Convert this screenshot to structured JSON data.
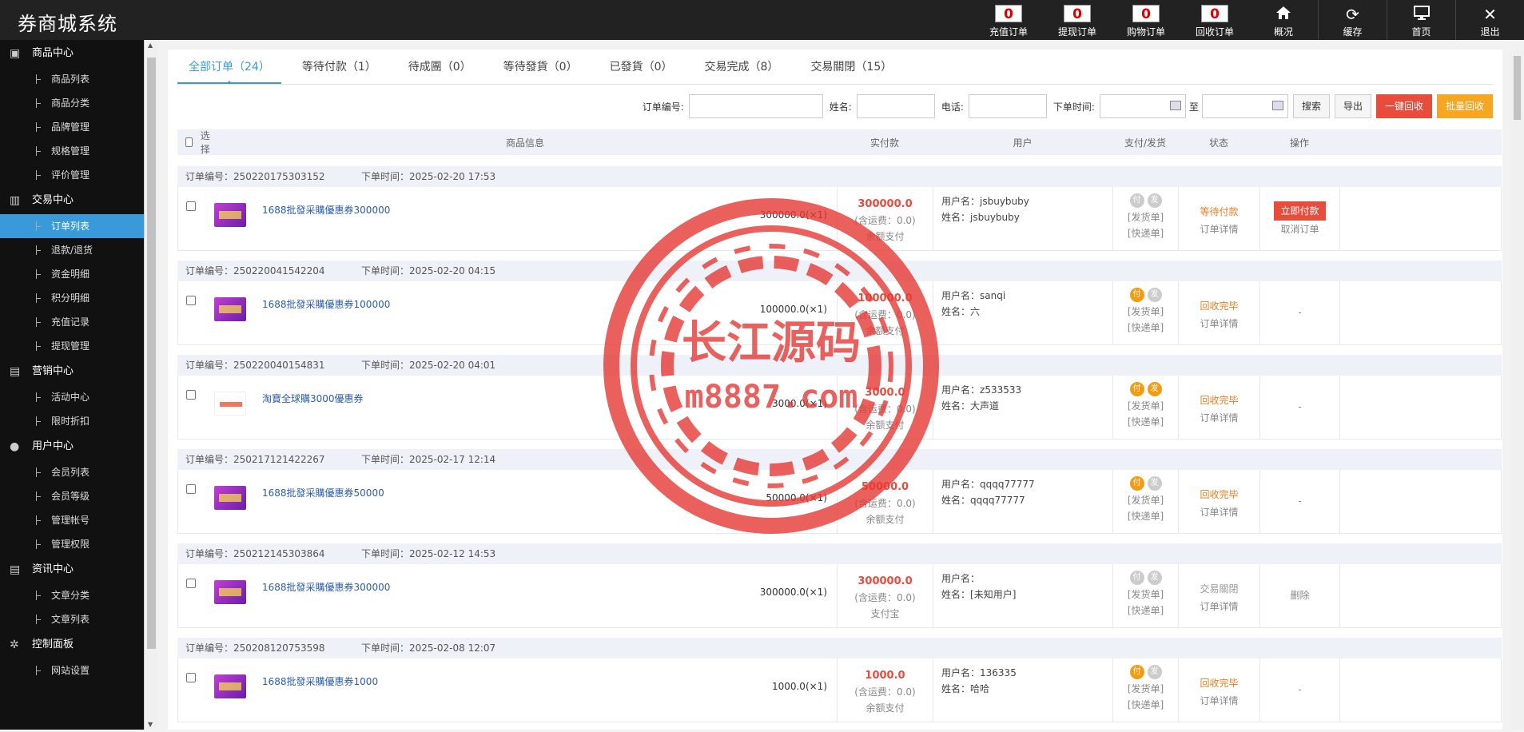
{
  "app": {
    "title": "券商城系统"
  },
  "topnav": [
    {
      "label": "充值订单",
      "count": "0",
      "icon": ""
    },
    {
      "label": "提现订单",
      "count": "0",
      "icon": ""
    },
    {
      "label": "购物订单",
      "count": "0",
      "icon": ""
    },
    {
      "label": "回收订单",
      "count": "0",
      "icon": ""
    },
    {
      "label": "概况",
      "count": "",
      "icon": "home-icon"
    },
    {
      "label": "缓存",
      "count": "",
      "icon": "refresh-icon"
    },
    {
      "label": "首页",
      "count": "",
      "icon": "monitor-icon"
    },
    {
      "label": "退出",
      "count": "",
      "icon": "close-icon"
    }
  ],
  "sidebar": [
    {
      "label": "商品中心",
      "icon": "product-icon",
      "items": [
        "商品列表",
        "商品分类",
        "品牌管理",
        "规格管理",
        "评价管理"
      ]
    },
    {
      "label": "交易中心",
      "icon": "chart-icon",
      "items": [
        "订单列表",
        "退款/退货",
        "资金明细",
        "积分明细",
        "充值记录",
        "提现管理"
      ]
    },
    {
      "label": "营销中心",
      "icon": "bar-chart-icon",
      "items": [
        "活动中心",
        "限时折扣"
      ]
    },
    {
      "label": "用户中心",
      "icon": "user-icon",
      "items": [
        "会员列表",
        "会员等级",
        "管理帐号",
        "管理权限"
      ]
    },
    {
      "label": "资讯中心",
      "icon": "document-icon",
      "items": [
        "文章分类",
        "文章列表"
      ]
    },
    {
      "label": "控制面板",
      "icon": "gear-icon",
      "items": [
        "网站设置"
      ]
    }
  ],
  "tabs": [
    "全部订单（24）",
    "等待付款（1）",
    "待成團（0）",
    "等待發貨（0）",
    "已發貨（0）",
    "交易完成（8）",
    "交易關閉（15）"
  ],
  "filters": {
    "order_no": "订单编号:",
    "name": "姓名:",
    "phone": "电话:",
    "time": "下单时间:",
    "to": "至",
    "search": "搜索",
    "export": "导出",
    "recycle_one": "一键回收",
    "recycle_batch": "批量回收"
  },
  "table_head": {
    "select": "选择",
    "info": "商品信息",
    "paid": "实付款",
    "user": "用户",
    "ship": "支付/发货",
    "status": "状态",
    "op": "操作"
  },
  "labels": {
    "order_no": "订单编号：",
    "time": "下单时间：",
    "shipping": "(含运费：0.0)",
    "username": "用户名：",
    "realname": "姓名：",
    "pay": "付",
    "ship": "发",
    "ship_note": "[发货单]",
    "express": "[快递单]",
    "detail": "订单详情"
  },
  "orders": [
    {
      "no": "250220175303152",
      "time": "2025-02-20 17:53",
      "name": "1688批發采購優惠券300000",
      "price": "300000.0(×1)",
      "amount": "300000.0",
      "method": "余额支付",
      "username": "jsbuybuby",
      "realname": "jsbuybuby",
      "status": "等待付款",
      "op1": "立即付款",
      "op2": "取消订单"
    },
    {
      "no": "250220041542204",
      "time": "2025-02-20 04:15",
      "name": "1688批發采購優惠券100000",
      "price": "100000.0(×1)",
      "amount": "100000.0",
      "method": "余额支付",
      "username": "sanqi",
      "realname": "六",
      "status": "回收完毕",
      "op1": "",
      "op2": "-"
    },
    {
      "no": "250220040154831",
      "time": "2025-02-20 04:01",
      "name": "淘寶全球購3000優惠券",
      "price": "3000.0(×1)",
      "amount": "3000.0",
      "method": "余额支付",
      "username": "z533533",
      "realname": "大声道",
      "status": "回收完毕",
      "op1": "",
      "op2": "-"
    },
    {
      "no": "250217121422267",
      "time": "2025-02-17 12:14",
      "name": "1688批發采購優惠券50000",
      "price": "50000.0(×1)",
      "amount": "50000.0",
      "method": "余额支付",
      "username": "qqqq77777",
      "realname": "qqqq77777",
      "status": "回收完毕",
      "op1": "",
      "op2": "-"
    },
    {
      "no": "250212145303864",
      "time": "2025-02-12 14:53",
      "name": "1688批發采購優惠券300000",
      "price": "300000.0(×1)",
      "amount": "300000.0",
      "method": "支付宝",
      "username": "",
      "realname": "[未知用户]",
      "status": "交易關閉",
      "op1": "",
      "op2": "删除"
    },
    {
      "no": "250208120753598",
      "time": "2025-02-08 12:07",
      "name": "1688批發采購優惠券1000",
      "price": "1000.0(×1)",
      "amount": "1000.0",
      "method": "余额支付",
      "username": "136335",
      "realname": "哈哈",
      "status": "回收完毕",
      "op1": "",
      "op2": "-"
    }
  ],
  "watermark": {
    "line1": "长江源码",
    "line2": "m8887.com"
  },
  "colors": {
    "accent": "#3a9ad9",
    "danger": "#e74c3c",
    "warning": "#f5a623",
    "topbar": "#222222",
    "sidebar": "#111111"
  }
}
